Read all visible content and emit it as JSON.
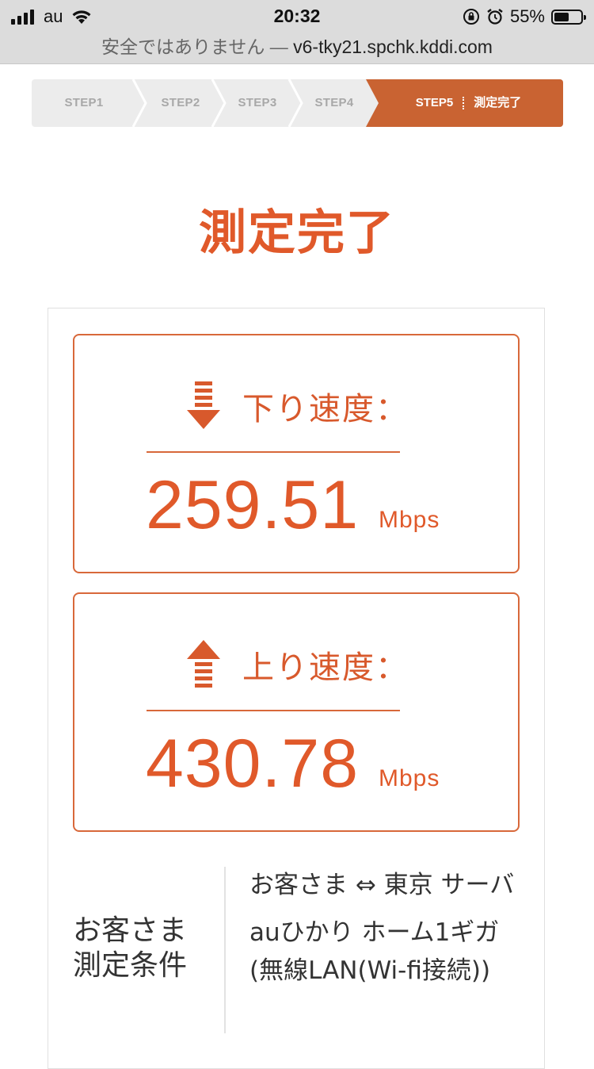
{
  "status_bar": {
    "carrier": "au",
    "time": "20:32",
    "battery_percent": "55%",
    "battery_level": 0.55
  },
  "url_bar": {
    "security_text": "安全ではありません —",
    "host": "v6-tky21.spchk.kddi.com"
  },
  "steps": {
    "items": [
      "STEP1",
      "STEP2",
      "STEP3",
      "STEP4"
    ],
    "active": "STEP5",
    "active_caption": "測定完了"
  },
  "title": "測定完了",
  "download": {
    "label": "下り速度：",
    "value": "259.51",
    "unit": "Mbps",
    "icon": "arrow-down-icon"
  },
  "upload": {
    "label": "上り速度：",
    "value": "430.78",
    "unit": "Mbps",
    "icon": "arrow-up-icon"
  },
  "conditions": {
    "label": "お客さま測定条件",
    "route": "お客さま ⇔ 東京 サーバ",
    "service": "auひかり ホーム1ギガ(無線LAN(Wi-fi接続))"
  },
  "colors": {
    "accent": "#e0592a",
    "step_active_bg": "#c96332",
    "card_border": "#d8683a"
  }
}
